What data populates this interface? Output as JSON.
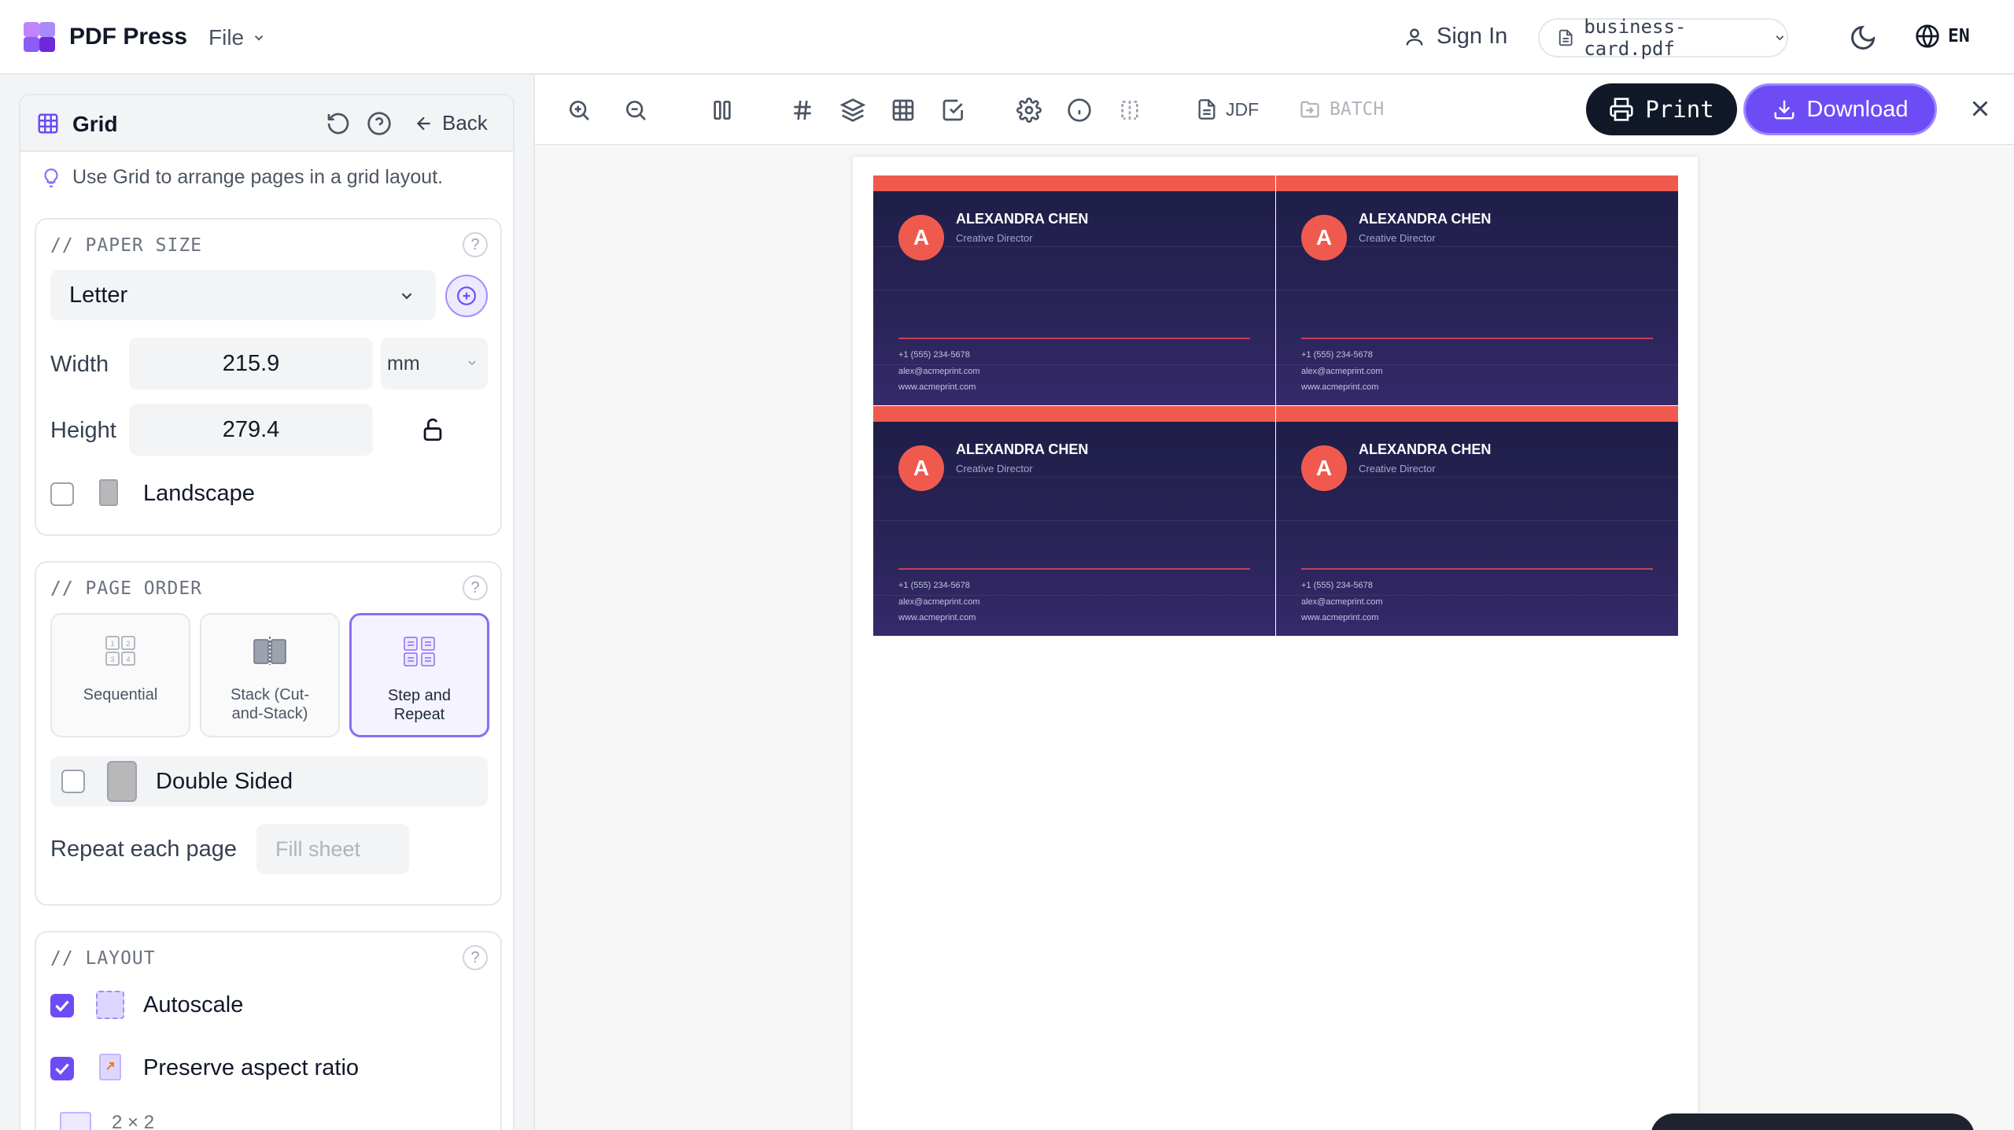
{
  "app": {
    "name": "PDF Press",
    "menu_file": "File",
    "sign_in": "Sign In",
    "filename": "business-card.pdf",
    "language": "EN"
  },
  "colors": {
    "accent": "#6d4cf5",
    "card_bar": "#f05a4e",
    "card_bg": "#1d1d45"
  },
  "sidebar": {
    "tool_title": "Grid",
    "back_label": "Back",
    "tip": "Use Grid to arrange pages in a grid layout.",
    "paper_size": {
      "title": "// PAPER SIZE",
      "preset": "Letter",
      "width_label": "Width",
      "width_value": "215.9",
      "unit": "mm",
      "height_label": "Height",
      "height_value": "279.4",
      "landscape_label": "Landscape",
      "landscape_checked": false
    },
    "page_order": {
      "title": "// PAGE ORDER",
      "options": [
        "Sequential",
        "Stack (Cut-and-Stack)",
        "Step and Repeat"
      ],
      "option_lines": [
        [
          "Sequential"
        ],
        [
          "Stack (Cut-",
          "and-Stack)"
        ],
        [
          "Step and",
          "Repeat"
        ]
      ],
      "selected": "Step and Repeat",
      "double_sided_label": "Double Sided",
      "double_sided_checked": false,
      "repeat_label": "Repeat each page",
      "repeat_placeholder": "Fill sheet"
    },
    "layout": {
      "title": "// LAYOUT",
      "autoscale_label": "Autoscale",
      "autoscale_checked": true,
      "preserve_label": "Preserve aspect ratio",
      "preserve_checked": true,
      "grid_size_label": "2 × 2"
    }
  },
  "toolbar": {
    "icons": [
      "zoom-in-icon",
      "zoom-out-icon",
      "columns-icon",
      "hash-icon",
      "layers-icon",
      "grid-icon",
      "check-square-icon",
      "settings-icon",
      "info-icon",
      "split-icon"
    ],
    "jdf_label": "JDF",
    "batch_label": "BATCH",
    "print_label": "Print",
    "download_label": "Download"
  },
  "preview": {
    "cards": [
      {
        "initial": "A",
        "name": "ALEXANDRA CHEN",
        "role": "Creative Director",
        "phone": "+1 (555) 234-5678",
        "email": "alex@acmeprint.com",
        "web": "www.acmeprint.com"
      },
      {
        "initial": "A",
        "name": "ALEXANDRA CHEN",
        "role": "Creative Director",
        "phone": "+1 (555) 234-5678",
        "email": "alex@acmeprint.com",
        "web": "www.acmeprint.com"
      },
      {
        "initial": "A",
        "name": "ALEXANDRA CHEN",
        "role": "Creative Director",
        "phone": "+1 (555) 234-5678",
        "email": "alex@acmeprint.com",
        "web": "www.acmeprint.com"
      },
      {
        "initial": "A",
        "name": "ALEXANDRA CHEN",
        "role": "Creative Director",
        "phone": "+1 (555) 234-5678",
        "email": "alex@acmeprint.com",
        "web": "www.acmeprint.com"
      }
    ]
  }
}
